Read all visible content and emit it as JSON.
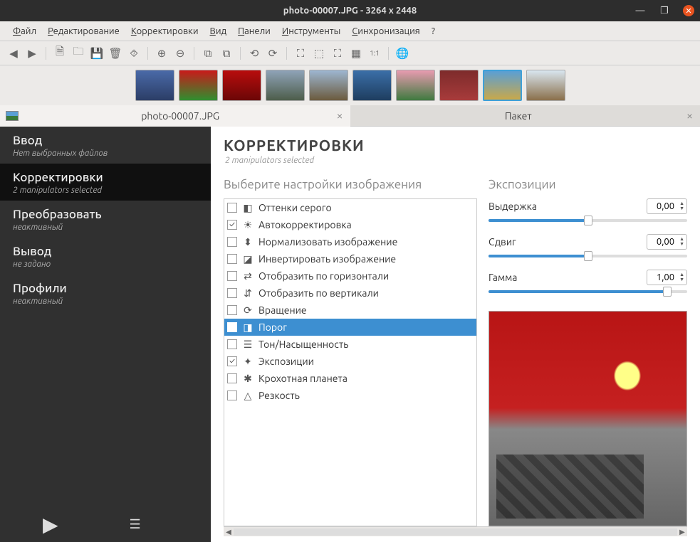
{
  "window": {
    "title": "photo-00007.JPG  - 3264 x 2448"
  },
  "menu": {
    "file": "Файл",
    "edit": "Редактирование",
    "adjust": "Корректировки",
    "view": "Вид",
    "panels": "Панели",
    "tools": "Инструменты",
    "sync": "Синхронизация",
    "help": "?"
  },
  "tabs": {
    "image": "photo-00007.JPG",
    "batch": "Пакет"
  },
  "sidebar": {
    "input": {
      "title": "Ввод",
      "sub": "Нет выбранных файлов"
    },
    "adjust": {
      "title": "Корректировки",
      "sub": "2 manipulators selected"
    },
    "transform": {
      "title": "Преобразовать",
      "sub": "неактивный"
    },
    "output": {
      "title": "Вывод",
      "sub": "не задано"
    },
    "profiles": {
      "title": "Профили",
      "sub": "неактивный"
    }
  },
  "content": {
    "heading": "КОРРЕКТИРОВКИ",
    "subtitle": "2 manipulators selected",
    "settings_hdr": "Выберите настройки изображения",
    "exposure_hdr": "Экспозиции"
  },
  "manipulators": [
    {
      "label": "Оттенки серого",
      "checked": false,
      "selected": false
    },
    {
      "label": "Автокорректировка",
      "checked": true,
      "selected": false
    },
    {
      "label": "Нормализовать изображение",
      "checked": false,
      "selected": false
    },
    {
      "label": "Инвертировать изображение",
      "checked": false,
      "selected": false
    },
    {
      "label": "Отобразить по горизонтали",
      "checked": false,
      "selected": false
    },
    {
      "label": "Отобразить по вертикали",
      "checked": false,
      "selected": false
    },
    {
      "label": "Вращение",
      "checked": false,
      "selected": false
    },
    {
      "label": "Порог",
      "checked": false,
      "selected": true
    },
    {
      "label": "Тон/Насыщенность",
      "checked": false,
      "selected": false
    },
    {
      "label": "Экспозиции",
      "checked": true,
      "selected": false
    },
    {
      "label": "Крохотная планета",
      "checked": false,
      "selected": false
    },
    {
      "label": "Резкость",
      "checked": false,
      "selected": false
    }
  ],
  "exposure": {
    "shutter": {
      "label": "Выдержка",
      "value": "0,00",
      "fill": 50
    },
    "shift": {
      "label": "Сдвиг",
      "value": "0,00",
      "fill": 50
    },
    "gamma": {
      "label": "Гамма",
      "value": "1,00",
      "fill": 90
    }
  },
  "thumbs": [
    {
      "bg": "linear-gradient(#4a6aa8,#2b3d66)"
    },
    {
      "bg": "linear-gradient(#c91a1a,#2f8f2f)"
    },
    {
      "bg": "linear-gradient(#b80d0d,#6b0606)"
    },
    {
      "bg": "linear-gradient(#8fa3b8,#4d5d4a)"
    },
    {
      "bg": "linear-gradient(#9db6d1,#6b5a3d)"
    },
    {
      "bg": "linear-gradient(#3b6fa8,#1e3d5f)"
    },
    {
      "bg": "linear-gradient(#e89bb0,#3f7a3f)"
    },
    {
      "bg": "linear-gradient(#7d2b2b,#a83b3b)"
    },
    {
      "bg": "linear-gradient(#5a9fd4,#c9a84a)"
    },
    {
      "bg": "linear-gradient(#d9e6f0,#8a6f4a)"
    }
  ],
  "thumb_selected": 8
}
